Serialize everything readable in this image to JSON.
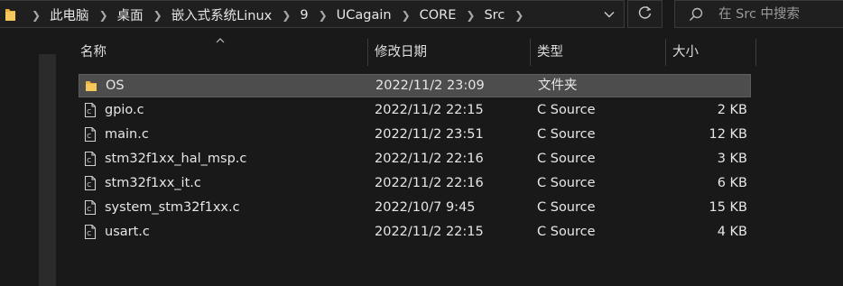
{
  "address_bar": {
    "breadcrumbs": [
      "此电脑",
      "桌面",
      "嵌入式系统Linux",
      "9",
      "UCagain",
      "CORE",
      "Src"
    ]
  },
  "search": {
    "placeholder": "在 Src 中搜索"
  },
  "columns": {
    "name": "名称",
    "date": "修改日期",
    "type": "类型",
    "size": "大小"
  },
  "files": [
    {
      "name": "OS",
      "date": "2022/11/2 23:09",
      "type": "文件夹",
      "size": "",
      "icon": "folder-icon",
      "selected": true
    },
    {
      "name": "gpio.c",
      "date": "2022/11/2 22:15",
      "type": "C Source",
      "size": "2 KB",
      "icon": "c-file-icon"
    },
    {
      "name": "main.c",
      "date": "2022/11/2 23:51",
      "type": "C Source",
      "size": "12 KB",
      "icon": "c-file-icon"
    },
    {
      "name": "stm32f1xx_hal_msp.c",
      "date": "2022/11/2 22:16",
      "type": "C Source",
      "size": "3 KB",
      "icon": "c-file-icon"
    },
    {
      "name": "stm32f1xx_it.c",
      "date": "2022/11/2 22:16",
      "type": "C Source",
      "size": "6 KB",
      "icon": "c-file-icon"
    },
    {
      "name": "system_stm32f1xx.c",
      "date": "2022/10/7 9:45",
      "type": "C Source",
      "size": "15 KB",
      "icon": "c-file-icon"
    },
    {
      "name": "usart.c",
      "date": "2022/11/2 22:15",
      "type": "C Source",
      "size": "4 KB",
      "icon": "c-file-icon"
    }
  ],
  "colors": {
    "background": "#191919",
    "selected_row": "#4d4d4d",
    "folder": "#f2c14e",
    "text": "#e6e6e6"
  }
}
